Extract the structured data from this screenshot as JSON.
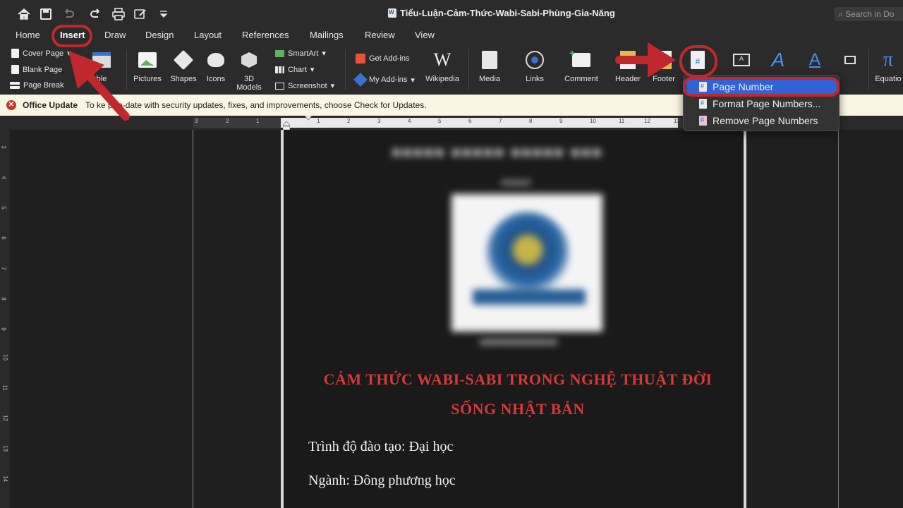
{
  "window": {
    "title": "Tiểu-Luận-Cảm-Thức-Wabi-Sabi-Phùng-Gia-Năng",
    "search_placeholder": "Search in Do"
  },
  "tabs": [
    "Home",
    "Insert",
    "Draw",
    "Design",
    "Layout",
    "References",
    "Mailings",
    "Review",
    "View"
  ],
  "active_tab": "Insert",
  "ribbon": {
    "pages": [
      "Cover Page",
      "Blank Page",
      "Page Break"
    ],
    "table_label": "ble",
    "illustrations": [
      "Pictures",
      "Shapes",
      "Icons"
    ],
    "models_label_1": "3D",
    "models_label_2": "Models",
    "smart": [
      "SmartArt",
      "Chart",
      "Screenshot"
    ],
    "addins": [
      "Get Add-ins",
      "My Add-ins"
    ],
    "wikipedia": "Wikipedia",
    "media": "Media",
    "links": "Links",
    "comment": "Comment",
    "header": "Header",
    "footer": "Footer",
    "equation": "Equatio"
  },
  "update_bar": {
    "title": "Office Update",
    "message": "To ke      p-to-date with security updates, fixes, and improvements, choose Check for Updates."
  },
  "ruler_numbers": [
    "3",
    "2",
    "1",
    "1",
    "2",
    "3",
    "4",
    "5",
    "6",
    "7",
    "8",
    "9",
    "10",
    "11",
    "12",
    "13"
  ],
  "vruler_numbers": [
    "3",
    "4",
    "5",
    "6",
    "7",
    "8",
    "9",
    "10",
    "11",
    "12",
    "13",
    "14"
  ],
  "document": {
    "heading_line1": "CẢM THỨC WABI-SABI TRONG NGHỆ THUẬT ĐỜI",
    "heading_line2": "SỐNG NHẬT BẢN",
    "para1": "Trình độ đào tạo: Đại học",
    "para2": "Ngành: Đông phương học"
  },
  "page_number_menu": {
    "items": [
      "Page Number",
      "Format Page Numbers...",
      "Remove Page Numbers"
    ],
    "selected": "Page Number"
  },
  "colors": {
    "annotation_red": "#c0282d",
    "selection_blue": "#2f63d6",
    "heading_red": "#d43a3a"
  }
}
